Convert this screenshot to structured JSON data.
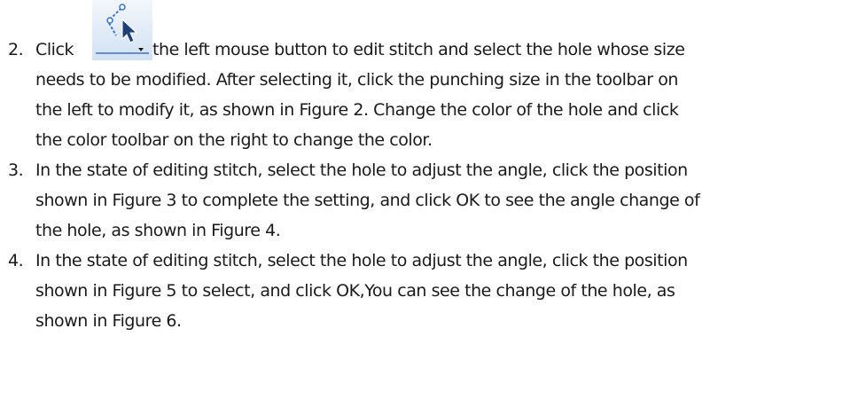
{
  "items": [
    {
      "number": "2.",
      "lead": "Click",
      "icon": "edit-stitch-tool-icon",
      "lines": [
        "the left mouse button to edit stitch and select the hole whose size",
        "needs to be modified. After selecting it, click the punching size in the toolbar on",
        "the left to modify it, as shown in Figure 2. Change the color of the hole and click",
        "the color toolbar on the right to change the color."
      ]
    },
    {
      "number": "3.",
      "lines": [
        "In the state of editing stitch, select the hole to adjust the angle, click the position",
        "shown in Figure 3 to complete the setting, and click OK to see the angle change of",
        "the hole, as shown in Figure 4."
      ]
    },
    {
      "number": "4.",
      "lines": [
        "In the state of editing stitch, select the hole to adjust the angle, click the position",
        "shown in Figure 5 to select, and click OK,You can see the change of the hole, as",
        "shown in Figure 6."
      ]
    }
  ],
  "colors": {
    "text": "#1a1a1a",
    "icon_blue": "#3c73c6",
    "icon_bg": "#dfeaf6"
  }
}
